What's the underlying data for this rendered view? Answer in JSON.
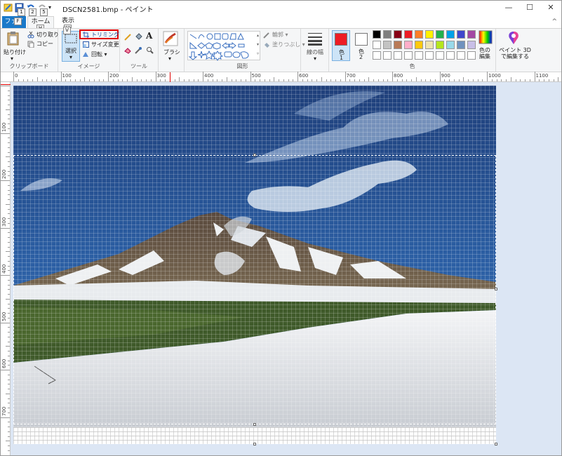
{
  "window": {
    "title": "DSCN2581.bmp - ペイント",
    "minimize": "—",
    "maximize": "☐",
    "close": "✕",
    "help_chevron": "^"
  },
  "quick_access": {
    "keytips": [
      "1",
      "2",
      "5"
    ]
  },
  "tabs": {
    "file": "ファイル",
    "home": "ホーム",
    "view": "表示",
    "keytip_file": "F",
    "keytip_home": "H",
    "keytip_view": "V"
  },
  "ribbon": {
    "clipboard": {
      "paste": "貼り付け",
      "cut": "切り取り",
      "copy": "コピー",
      "group": "クリップボード"
    },
    "image": {
      "select": "選択",
      "trim": "トリミング",
      "resize": "サイズ変更",
      "rotate": "回転 ▾",
      "group": "イメージ"
    },
    "tools": {
      "group": "ツール",
      "text_tool": "A"
    },
    "brushes": {
      "label": "ブラシ"
    },
    "shapes": {
      "outline": "輪郭 ▾",
      "fill": "塗りつぶし ▾",
      "group": "図形"
    },
    "size": {
      "label": "線の幅"
    },
    "colors": {
      "color1": "色\n1",
      "color1_label": "色",
      "color1_num": "1",
      "color2_label": "色",
      "color2_num": "2",
      "edit": "色の\n編集",
      "edit_line1": "色の",
      "edit_line2": "編集",
      "paint3d_line1": "ペイント 3D",
      "paint3d_line2": "で編集する",
      "group": "色",
      "color1_value": "#ed1c24",
      "color2_value": "#ffffff",
      "palette_row1": [
        "#000000",
        "#7f7f7f",
        "#880015",
        "#ed1c24",
        "#ff7f27",
        "#fff200",
        "#22b14c",
        "#00a2e8",
        "#3f48cc",
        "#a349a4"
      ],
      "palette_row2": [
        "#ffffff",
        "#c3c3c3",
        "#b97a57",
        "#ffaec9",
        "#ffc90e",
        "#efe4b0",
        "#b5e61d",
        "#99d9ea",
        "#7092be",
        "#c8bfe7"
      ],
      "palette_row3": [
        "#ffffff",
        "#ffffff",
        "#ffffff",
        "#ffffff",
        "#ffffff",
        "#ffffff",
        "#ffffff",
        "#ffffff",
        "#ffffff",
        "#ffffff"
      ]
    }
  },
  "ruler": {
    "h_labels": [
      "0",
      "100",
      "200",
      "300",
      "400",
      "500",
      "600",
      "700",
      "800",
      "900",
      "1000",
      "1100"
    ],
    "v_labels": [
      "100",
      "200",
      "300",
      "400",
      "500",
      "600",
      "700"
    ]
  }
}
